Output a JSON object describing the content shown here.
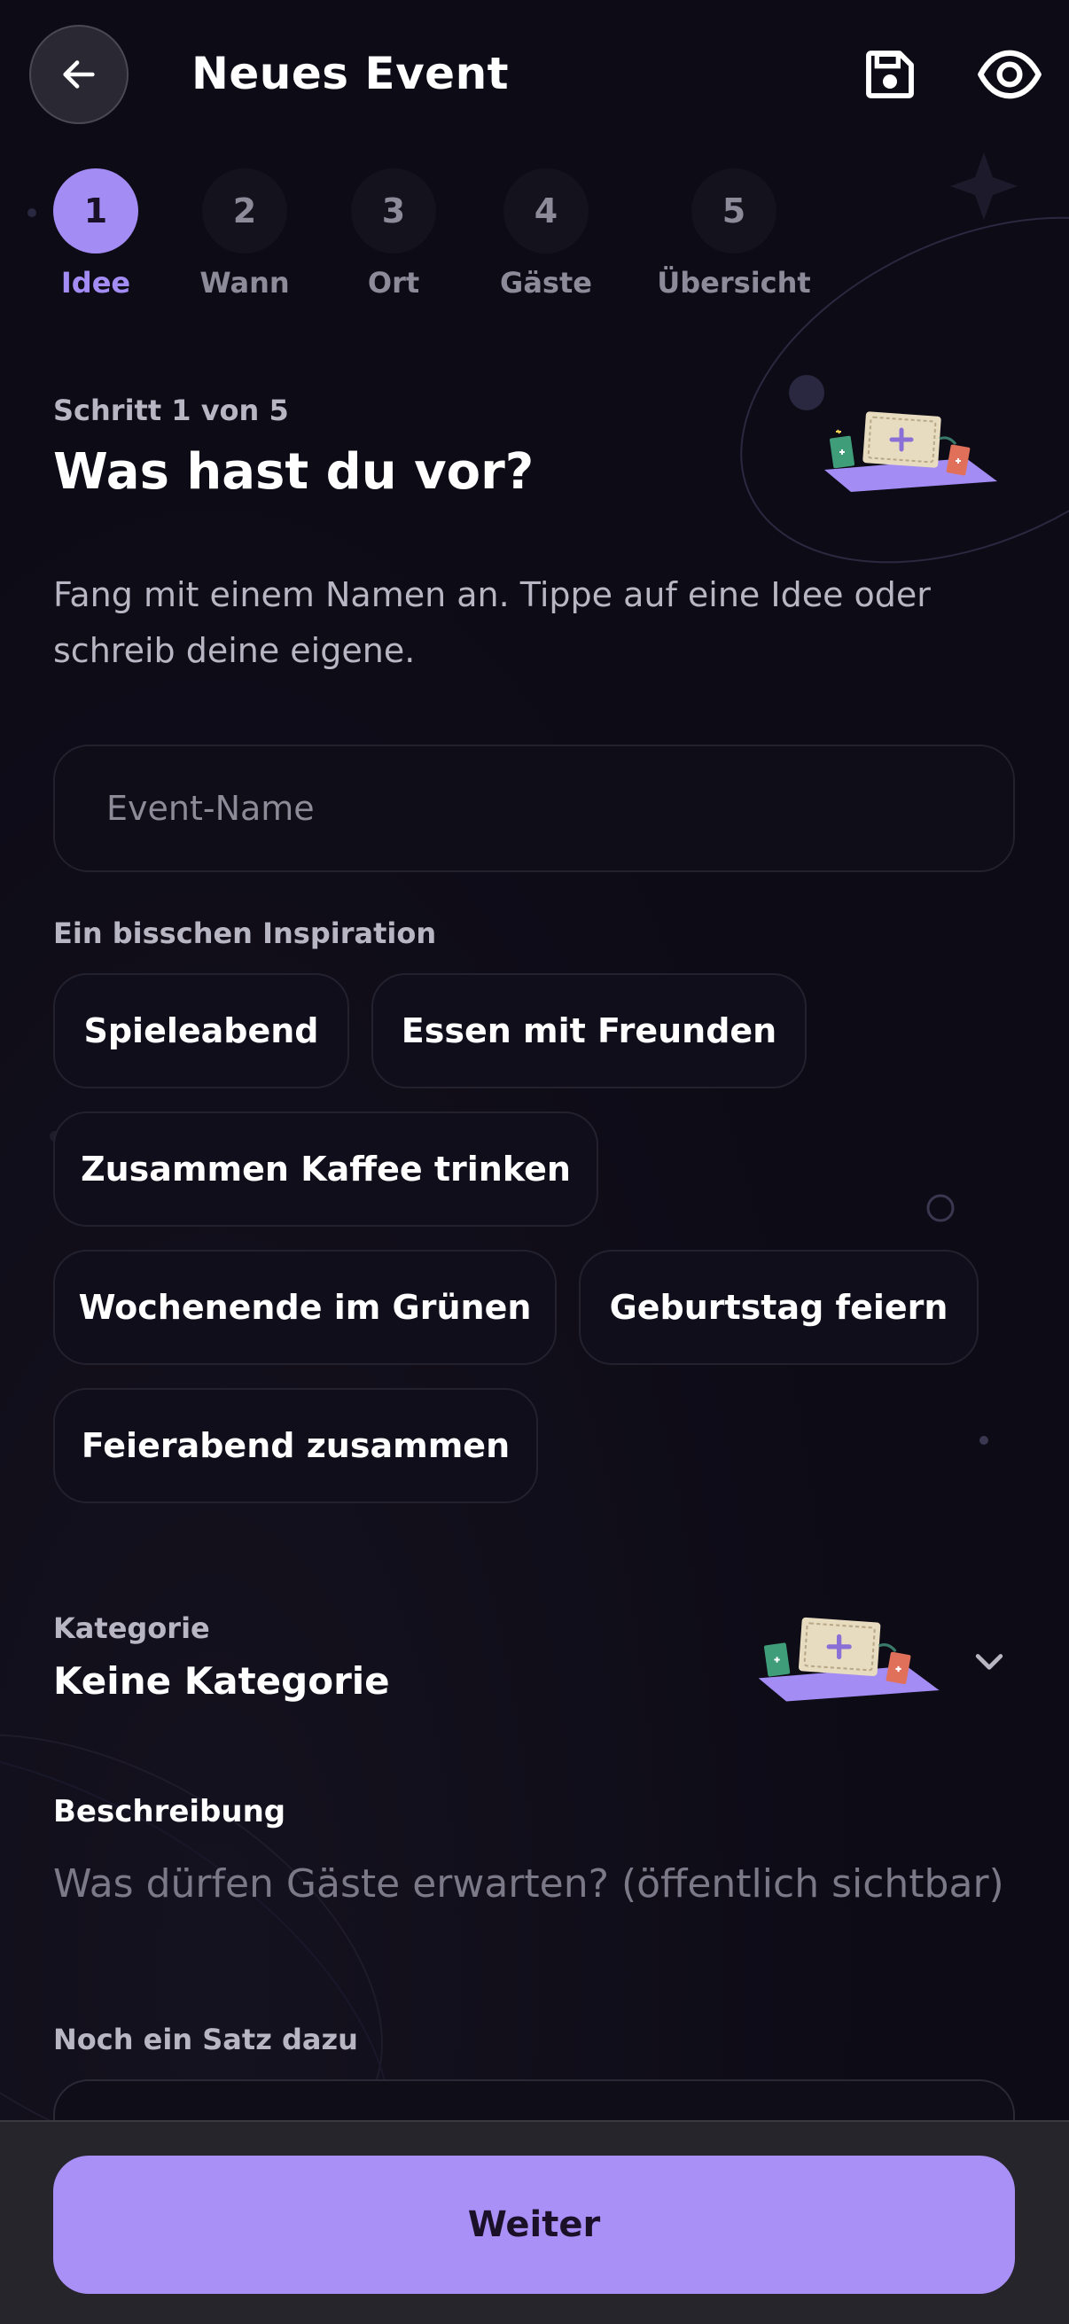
{
  "header": {
    "title": "Neues Event"
  },
  "stepper": {
    "steps": [
      {
        "number": "1",
        "label": "Idee"
      },
      {
        "number": "2",
        "label": "Wann"
      },
      {
        "number": "3",
        "label": "Ort"
      },
      {
        "number": "4",
        "label": "Gäste"
      },
      {
        "number": "5",
        "label": "Übersicht"
      }
    ],
    "active_index": 0
  },
  "intro": {
    "step_count": "Schritt 1 von 5",
    "heading": "Was hast du vor?",
    "text": "Fang mit einem Namen an. Tippe auf eine Idee oder schreib deine eigene."
  },
  "event_name": {
    "placeholder": "Event-Name",
    "value": ""
  },
  "inspiration": {
    "label": "Ein bisschen Inspiration",
    "chips": [
      "Spieleabend",
      "Essen mit Freunden",
      "Zusammen Kaffee trinken",
      "Wochenende im Grünen",
      "Geburtstag feiern",
      "Feierabend zusammen"
    ]
  },
  "category": {
    "label": "Kategorie",
    "value": "Keine Kategorie"
  },
  "description": {
    "label": "Beschreibung",
    "placeholder": "Was dürfen Gäste erwarten? (öffentlich sichtbar)"
  },
  "extra": {
    "label": "Noch ein Satz dazu"
  },
  "footer": {
    "next_label": "Weiter"
  },
  "icons": {
    "back": "arrow-left-icon",
    "save": "save-icon",
    "preview": "eye-icon",
    "category_toggle": "chevron-down-icon"
  },
  "colors": {
    "background": "#0d0b16",
    "accent": "#a48cf5",
    "button": "#a990f7",
    "muted_text": "#b9b6c4",
    "bottom_bar": "#25252b"
  }
}
